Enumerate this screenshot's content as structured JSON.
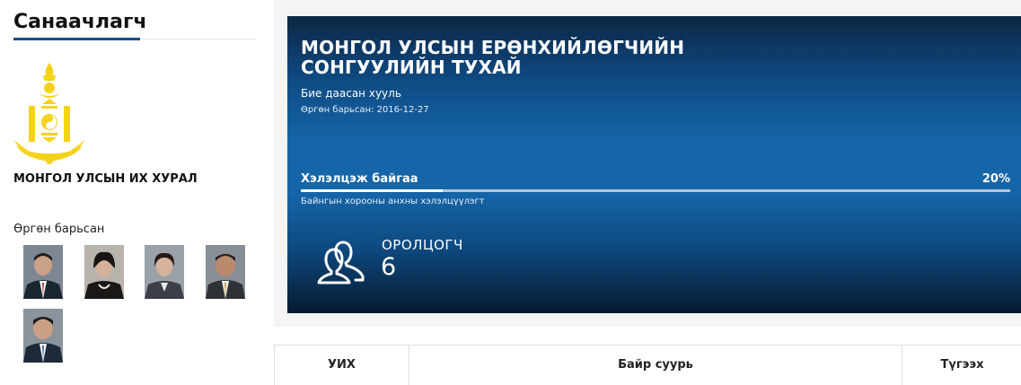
{
  "sidebar": {
    "title": "Санаачлагч",
    "org_name": "МОНГОЛ УЛСЫН ИХ ХУРАЛ",
    "submitted_label": "Өргөн барьсан",
    "avatar_count": 5
  },
  "law": {
    "title": "МОНГОЛ УЛСЫН ЕРӨНХИЙЛӨГЧИЙН СОНГУУЛИЙН ТУХАЙ",
    "type": "Бие даасан хууль",
    "submitted_date": "Өргөн барьсан: 2016-12-27",
    "status": "Хэлэлцэж байгаа",
    "progress_text": "20%",
    "progress_fraction": 0.2,
    "stage": "Байнгын хорооны анхны хэлэлцүүлэгт",
    "participants_label": "ОРОЛЦОГЧ",
    "participants_count": "6"
  },
  "table": {
    "columns": [
      "УИХ",
      "Байр суурь",
      "Түгээх"
    ]
  },
  "colors": {
    "accent": "#1a4f8a",
    "card_blue": "#1565a8",
    "emblem_yellow": "#f5d21a"
  },
  "icons": {
    "emblem": "soyombo-emblem-icon",
    "participants": "users-icon"
  }
}
